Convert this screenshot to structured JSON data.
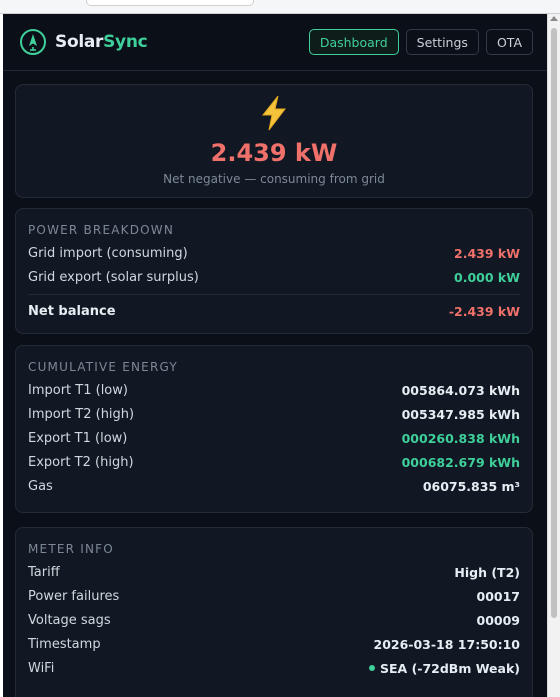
{
  "brand": {
    "name_part1": "Solar",
    "name_part2": "Sync"
  },
  "nav": [
    {
      "label": "Dashboard",
      "active": true
    },
    {
      "label": "Settings",
      "active": false
    },
    {
      "label": "OTA",
      "active": false
    }
  ],
  "hero": {
    "icon": "lightning-bolt-icon",
    "value": "2.439 kW",
    "subtitle": "Net negative — consuming from grid"
  },
  "power_breakdown": {
    "title": "POWER BREAKDOWN",
    "rows": [
      {
        "label": "Grid import (consuming)",
        "value": "2.439 kW",
        "tone": "neg"
      },
      {
        "label": "Grid export (solar surplus)",
        "value": "0.000 kW",
        "tone": "pos"
      }
    ],
    "net": {
      "label": "Net balance",
      "value": "-2.439 kW",
      "tone": "neg"
    }
  },
  "cumulative_energy": {
    "title": "CUMULATIVE ENERGY",
    "rows": [
      {
        "label": "Import T1 (low)",
        "value": "005864.073 kWh",
        "tone": "plain"
      },
      {
        "label": "Import T2 (high)",
        "value": "005347.985 kWh",
        "tone": "plain"
      },
      {
        "label": "Export T1 (low)",
        "value": "000260.838 kWh",
        "tone": "pos"
      },
      {
        "label": "Export T2 (high)",
        "value": "000682.679 kWh",
        "tone": "pos"
      },
      {
        "label": "Gas",
        "value": "06075.835 m³",
        "tone": "plain"
      }
    ]
  },
  "meter_info": {
    "title": "METER INFO",
    "rows": [
      {
        "label": "Tariff",
        "value": "High (T2)"
      },
      {
        "label": "Power failures",
        "value": "00017"
      },
      {
        "label": "Voltage sags",
        "value": "00009"
      },
      {
        "label": "Timestamp",
        "value": "2026-03-18 17:50:10"
      },
      {
        "label": "WiFi",
        "value": "SEA (-72dBm Weak)"
      }
    ]
  },
  "colors": {
    "background": "#0b1018",
    "card": "#111823",
    "accent": "#3ecf9a",
    "negative": "#f0706a",
    "bolt": "#f6c33d"
  }
}
